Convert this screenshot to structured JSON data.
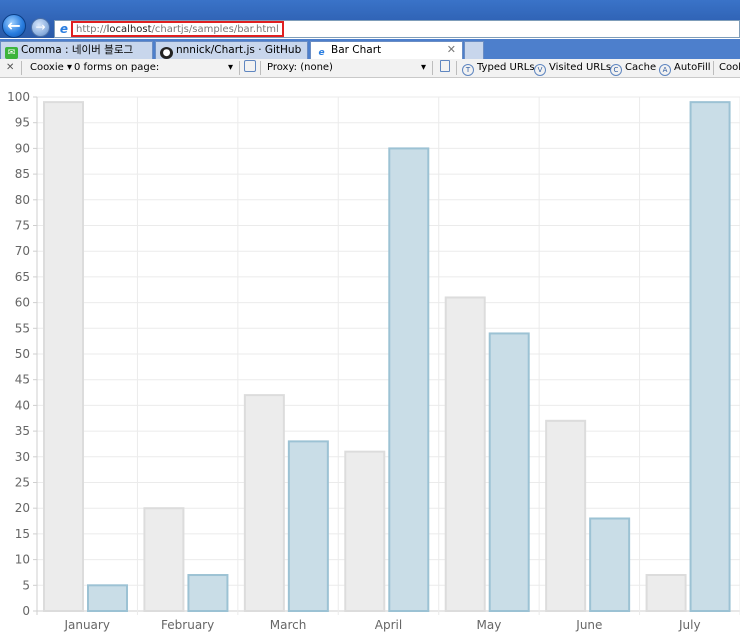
{
  "browser": {
    "url_prefix": "http://",
    "url_host": "localhost",
    "url_path": "/chartjs/samples/bar.html",
    "back_icon": "back-arrow-icon",
    "forward_icon": "forward-arrow-icon"
  },
  "tabs": [
    {
      "label": "Comma : 네이버 블로그",
      "icon": "naver-blog-icon"
    },
    {
      "label": "nnnick/Chart.js · GitHub",
      "icon": "github-icon"
    },
    {
      "label": "Bar Chart",
      "icon": "ie-icon",
      "active": true
    }
  ],
  "toolbar": {
    "close": "✕",
    "coockie": "Cooxie",
    "forms": "0 forms on page:",
    "proxy": "Proxy: (none)",
    "typed_urls": "Typed URLs",
    "visited_urls": "Visited URLs",
    "cache": "Cache",
    "autofill": "AutoFill",
    "cook": "Cook"
  },
  "chart_data": {
    "type": "bar",
    "categories": [
      "January",
      "February",
      "March",
      "April",
      "May",
      "June",
      "July"
    ],
    "series": [
      {
        "values": [
          99,
          20,
          42,
          31,
          61,
          37,
          7
        ],
        "fill": "#ececec",
        "stroke": "#dcdcdc"
      },
      {
        "values": [
          5,
          7,
          33,
          90,
          54,
          18,
          99
        ],
        "fill": "#c9dde7",
        "stroke": "#9cc2d4"
      }
    ],
    "ylim": [
      0,
      100
    ],
    "yticks": [
      "0",
      "5",
      "10",
      "15",
      "20",
      "25",
      "30",
      "35",
      "40",
      "45",
      "50",
      "55",
      "60",
      "65",
      "70",
      "75",
      "80",
      "85",
      "90",
      "95",
      "100"
    ],
    "grid": true
  }
}
